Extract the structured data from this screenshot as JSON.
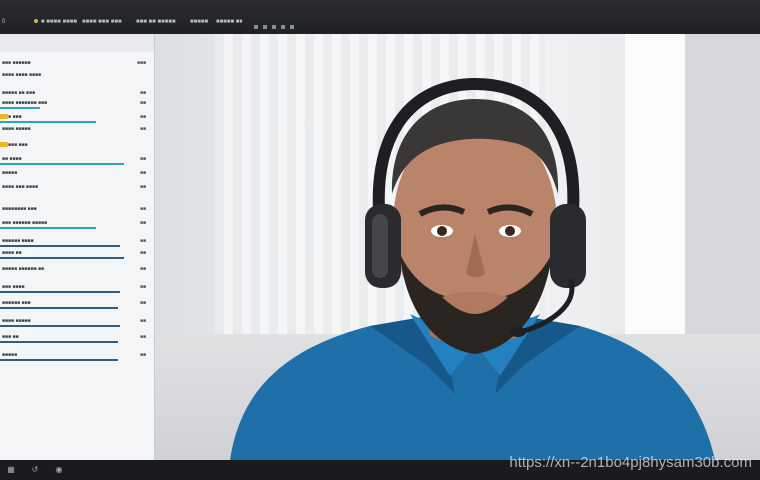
{
  "window": {
    "tabs": [
      {
        "label": "0"
      },
      {
        "label": "■ ■■■■ ■■■■"
      },
      {
        "label": "■■■■ ■■■ ■■■"
      },
      {
        "label": "■■■ ■■ ■■■■■"
      },
      {
        "label": "■■■■■"
      },
      {
        "label": "■■■■■ ■■"
      }
    ]
  },
  "sidebar": {
    "rows": [
      {
        "label": "■■■ ■■■■■■",
        "value": "■■■"
      },
      {
        "label": "■■■■ ■■■■ ■■■■",
        "value": ""
      },
      {
        "label": "■■■■■ ■■ ■■■",
        "value": "■■"
      },
      {
        "label": "■■■■ ■■■■■■■ ■■■",
        "value": "■■"
      },
      {
        "label": "■■■ ■■■",
        "value": "■■"
      },
      {
        "label": "■■■■ ■■■■■",
        "value": "■■"
      },
      {
        "label": "■■■■■ ■■■",
        "value": ""
      },
      {
        "label": "■■ ■■■■",
        "value": "■■"
      },
      {
        "label": "■■■■■",
        "value": "■■"
      },
      {
        "label": "■■■■ ■■■ ■■■■",
        "value": "■■"
      },
      {
        "label": "■■■■■■■■ ■■■",
        "value": "■■"
      },
      {
        "label": "■■■ ■■■■■■ ■■■■■",
        "value": "■■"
      },
      {
        "label": "■■■■■■ ■■■■",
        "value": "■■"
      },
      {
        "label": "■■■■ ■■",
        "value": "■■"
      },
      {
        "label": "■■■■■ ■■■■■■ ■■",
        "value": "■■"
      },
      {
        "label": "■■■ ■■■■",
        "value": "■■"
      },
      {
        "label": "■■■■■■ ■■■",
        "value": "■■"
      },
      {
        "label": "■■■■ ■■■■■",
        "value": "■■"
      },
      {
        "label": "■■■ ■■",
        "value": "■■"
      },
      {
        "label": "■■■■■",
        "value": "■■"
      }
    ],
    "accent": "#2aa7b8",
    "tag_color": "#f2b728"
  },
  "video": {
    "subject": "person"
  },
  "bottombar": {
    "icons": [
      "grid-icon",
      "undo-icon",
      "gamepad-icon"
    ]
  },
  "watermark": "https://xn--2n1bo4pj8hysam30b.com"
}
